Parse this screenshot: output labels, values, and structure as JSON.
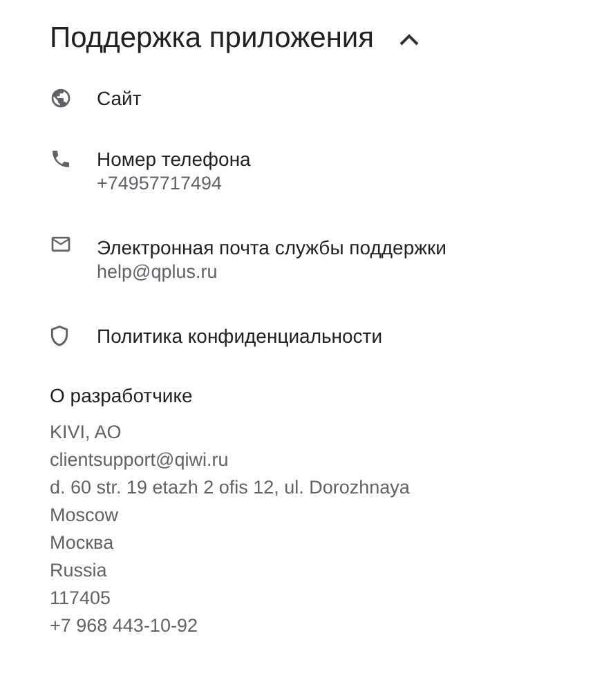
{
  "section": {
    "title": "Поддержка приложения",
    "expanded": true
  },
  "items": [
    {
      "kind": "globe",
      "label": "Сайт"
    },
    {
      "kind": "phone",
      "label": "Номер телефона",
      "detail": "+74957717494"
    },
    {
      "kind": "mail",
      "label": "Электронная почта службы поддержки",
      "detail": "help@qplus.ru"
    },
    {
      "kind": "shield",
      "label": "Политика конфиденциальности"
    }
  ],
  "developer": {
    "heading": "О разработчике",
    "lines": [
      "KIVI, AO",
      "clientsupport@qiwi.ru",
      "d. 60 str. 19 etazh 2 ofis 12, ul. Dorozhnaya",
      "Moscow",
      "Москва",
      "Russia",
      "117405",
      "+7 968 443-10-92"
    ]
  }
}
